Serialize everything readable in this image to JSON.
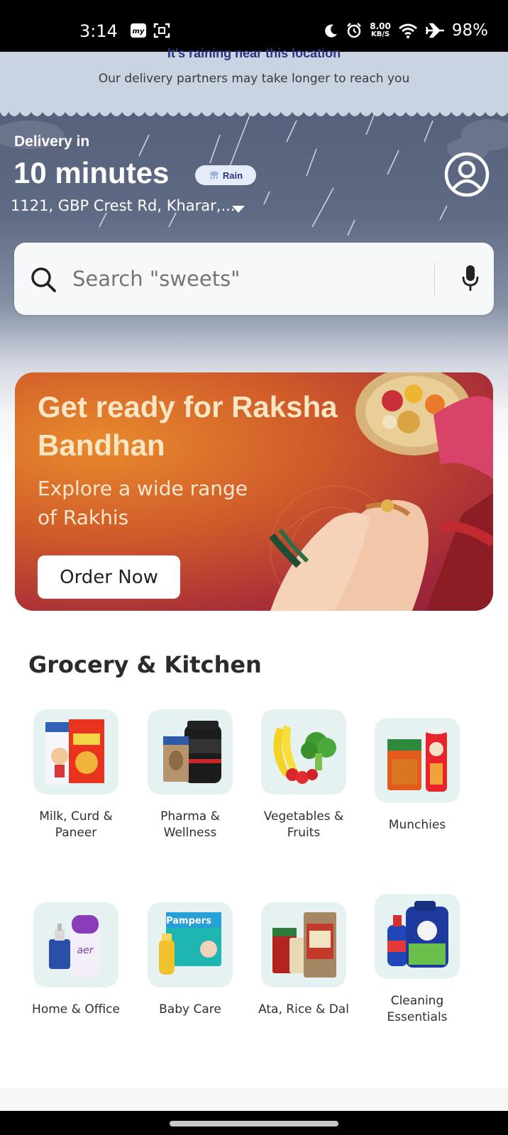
{
  "status_bar": {
    "time": "3:14",
    "net_speed_value": "8.00",
    "net_speed_unit": "KB/S",
    "battery": "98%"
  },
  "rain_banner": {
    "title": "It's raining near this location",
    "subtitle": "Our delivery partners may take longer to reach you"
  },
  "header": {
    "delivery_label": "Delivery in",
    "delivery_time": "10 minutes",
    "rain_chip": "Rain",
    "address": "1121, GBP Crest Rd, Kharar,..."
  },
  "search": {
    "placeholder": "Search \"sweets\""
  },
  "promo": {
    "title": "Get ready for Raksha Bandhan",
    "subtitle": "Explore a wide range of Rakhis",
    "button": "Order Now"
  },
  "section": {
    "title": "Grocery & Kitchen"
  },
  "categories": [
    {
      "label": "Milk, Curd & Paneer"
    },
    {
      "label": "Pharma & Wellness"
    },
    {
      "label": "Vegetables & Fruits"
    },
    {
      "label": "Munchies"
    },
    {
      "label": "Home & Office"
    },
    {
      "label": "Baby Care"
    },
    {
      "label": "Ata, Rice & Dal"
    },
    {
      "label": "Cleaning Essentials"
    }
  ],
  "colors": {
    "accent": "#2d3580",
    "tile_bg": "#e6f2f2"
  }
}
